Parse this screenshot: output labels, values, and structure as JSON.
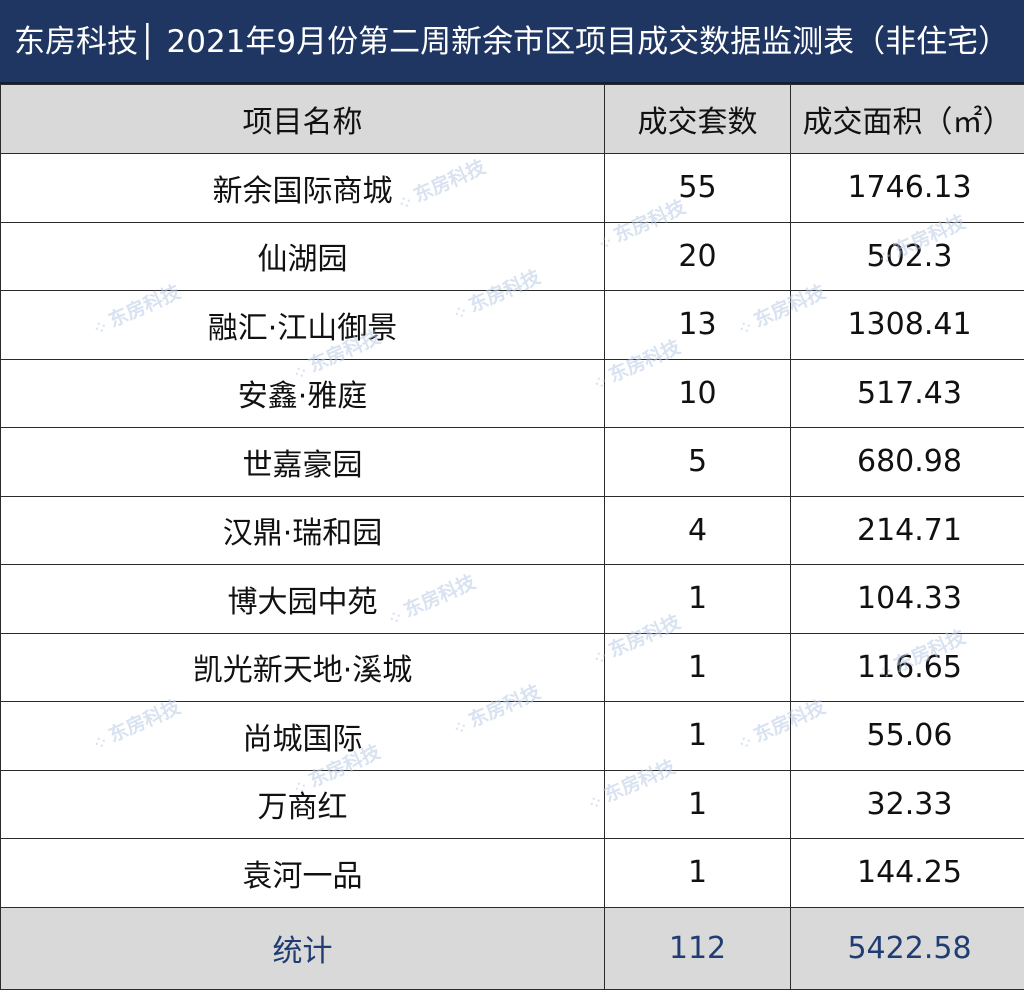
{
  "title": "东房科技│ 2021年9月份第二周新余市区项目成交数据监测表（非住宅）",
  "headers": [
    "项目名称",
    "成交套数",
    "成交面积（㎡）"
  ],
  "rows": [
    {
      "name": "新余国际商城",
      "units": "55",
      "area": "1746.13"
    },
    {
      "name": "仙湖园",
      "units": "20",
      "area": "502.3"
    },
    {
      "name": "融汇·江山御景",
      "units": "13",
      "area": "1308.41"
    },
    {
      "name": "安鑫·雅庭",
      "units": "10",
      "area": "517.43"
    },
    {
      "name": "世嘉豪园",
      "units": "5",
      "area": "680.98"
    },
    {
      "name": "汉鼎·瑞和园",
      "units": "4",
      "area": "214.71"
    },
    {
      "name": "博大园中苑",
      "units": "1",
      "area": "104.33"
    },
    {
      "name": "凯光新天地·溪城",
      "units": "1",
      "area": "116.65"
    },
    {
      "name": "尚城国际",
      "units": "1",
      "area": "55.06"
    },
    {
      "name": "万商红",
      "units": "1",
      "area": "32.33"
    },
    {
      "name": "袁河一品",
      "units": "1",
      "area": "144.25"
    }
  ],
  "total": {
    "label": "统计",
    "units": "112",
    "area": "5422.58"
  },
  "watermark_text": "东房科技",
  "colors": {
    "title_bg": "#1f3663",
    "header_bg": "#d9d9d9",
    "total_text": "#1f3d73",
    "watermark": "#b9cbe6"
  }
}
